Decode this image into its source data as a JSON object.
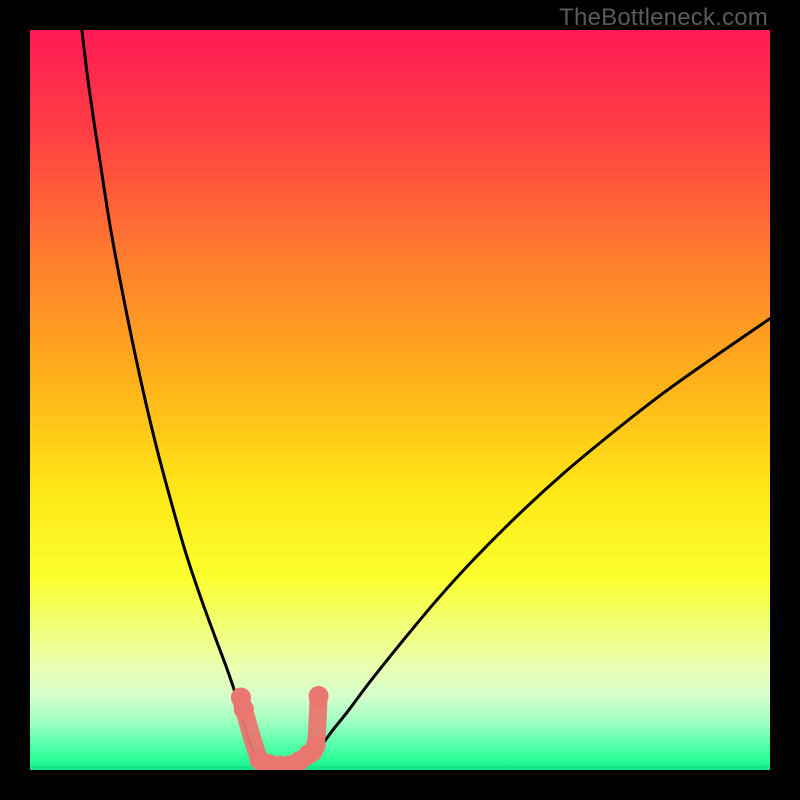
{
  "watermark": "TheBottleneck.com",
  "chart_data": {
    "type": "line",
    "title": "",
    "xlabel": "",
    "ylabel": "",
    "xlim": [
      0,
      100
    ],
    "ylim": [
      0,
      100
    ],
    "background_gradient_stops": [
      {
        "pos": 0.0,
        "color": "#ff1a55"
      },
      {
        "pos": 0.14,
        "color": "#ff3f44"
      },
      {
        "pos": 0.3,
        "color": "#ff7a2f"
      },
      {
        "pos": 0.48,
        "color": "#ffb31a"
      },
      {
        "pos": 0.62,
        "color": "#ffe617"
      },
      {
        "pos": 0.74,
        "color": "#fbff2e"
      },
      {
        "pos": 0.8,
        "color": "#f2ff70"
      },
      {
        "pos": 0.86,
        "color": "#eaffb0"
      },
      {
        "pos": 0.9,
        "color": "#d6ffcc"
      },
      {
        "pos": 0.93,
        "color": "#a8ffc4"
      },
      {
        "pos": 0.96,
        "color": "#63ffb0"
      },
      {
        "pos": 0.985,
        "color": "#2cff9a"
      },
      {
        "pos": 1.0,
        "color": "#18e889"
      }
    ],
    "series": [
      {
        "name": "left-curve",
        "stroke": "#000000",
        "points": [
          {
            "x": 7.0,
            "y": 100.0
          },
          {
            "x": 8.0,
            "y": 92.0
          },
          {
            "x": 9.5,
            "y": 82.0
          },
          {
            "x": 11.0,
            "y": 72.5
          },
          {
            "x": 13.0,
            "y": 62.0
          },
          {
            "x": 15.0,
            "y": 52.5
          },
          {
            "x": 17.0,
            "y": 44.0
          },
          {
            "x": 19.0,
            "y": 36.5
          },
          {
            "x": 21.0,
            "y": 29.5
          },
          {
            "x": 23.0,
            "y": 23.5
          },
          {
            "x": 25.0,
            "y": 18.0
          },
          {
            "x": 26.5,
            "y": 14.0
          },
          {
            "x": 27.7,
            "y": 10.5
          },
          {
            "x": 28.6,
            "y": 7.5
          },
          {
            "x": 29.3,
            "y": 5.0
          },
          {
            "x": 29.9,
            "y": 3.2
          },
          {
            "x": 30.7,
            "y": 1.5
          },
          {
            "x": 31.5,
            "y": 0.7
          },
          {
            "x": 32.5,
            "y": 0.3
          }
        ]
      },
      {
        "name": "right-curve",
        "stroke": "#000000",
        "points": [
          {
            "x": 36.0,
            "y": 0.3
          },
          {
            "x": 37.0,
            "y": 0.8
          },
          {
            "x": 38.0,
            "y": 1.8
          },
          {
            "x": 39.5,
            "y": 3.5
          },
          {
            "x": 41.0,
            "y": 5.5
          },
          {
            "x": 43.0,
            "y": 8.0
          },
          {
            "x": 46.0,
            "y": 12.0
          },
          {
            "x": 50.0,
            "y": 17.0
          },
          {
            "x": 55.0,
            "y": 23.0
          },
          {
            "x": 60.0,
            "y": 28.5
          },
          {
            "x": 66.0,
            "y": 34.5
          },
          {
            "x": 72.0,
            "y": 40.0
          },
          {
            "x": 78.0,
            "y": 45.0
          },
          {
            "x": 85.0,
            "y": 50.5
          },
          {
            "x": 92.0,
            "y": 55.5
          },
          {
            "x": 100.0,
            "y": 61.0
          }
        ]
      },
      {
        "name": "valley-markers",
        "stroke": "#e9766f",
        "fill": "#e9766f",
        "marker_radius_px": 10,
        "points": [
          {
            "x": 28.5,
            "y": 9.8
          },
          {
            "x": 28.9,
            "y": 8.2
          },
          {
            "x": 31.0,
            "y": 1.4
          },
          {
            "x": 32.3,
            "y": 0.8
          },
          {
            "x": 33.8,
            "y": 0.6
          },
          {
            "x": 35.3,
            "y": 0.7
          },
          {
            "x": 36.4,
            "y": 1.2
          },
          {
            "x": 37.6,
            "y": 2.1
          },
          {
            "x": 38.6,
            "y": 3.3
          },
          {
            "x": 39.0,
            "y": 10.0
          }
        ]
      }
    ]
  }
}
